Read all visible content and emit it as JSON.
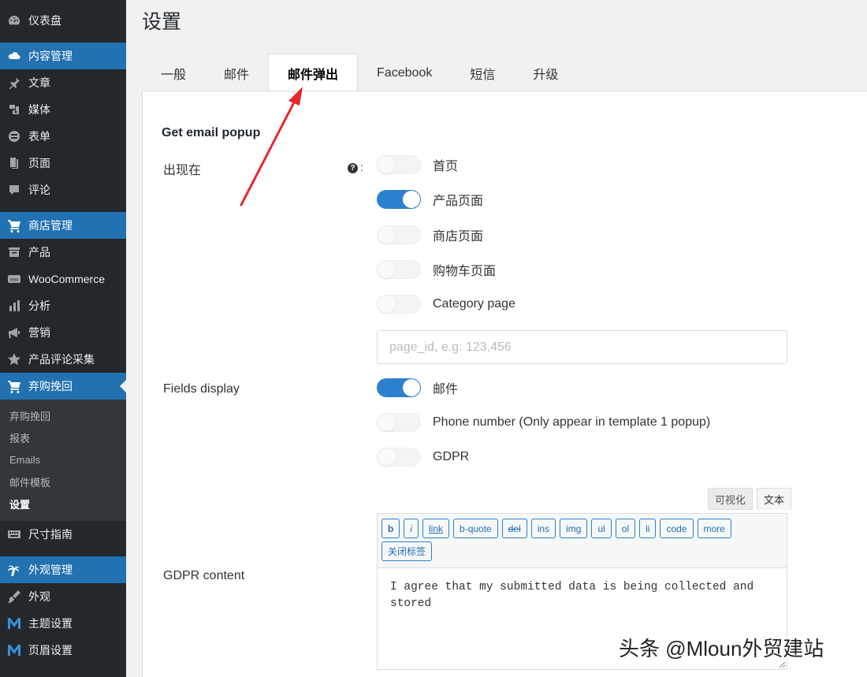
{
  "sidebar": {
    "items": [
      {
        "key": "dashboard",
        "label": "仪表盘",
        "icon": "dashboard-icon",
        "style": "normal"
      },
      {
        "key": "content-mgmt",
        "label": "内容管理",
        "icon": "cloud-icon",
        "style": "head"
      },
      {
        "key": "posts",
        "label": "文章",
        "icon": "pin-icon",
        "style": "normal"
      },
      {
        "key": "media",
        "label": "媒体",
        "icon": "media-icon",
        "style": "normal"
      },
      {
        "key": "forms",
        "label": "表单",
        "icon": "form-icon",
        "style": "normal"
      },
      {
        "key": "pages",
        "label": "页面",
        "icon": "page-icon",
        "style": "normal"
      },
      {
        "key": "comments",
        "label": "评论",
        "icon": "comment-icon",
        "style": "normal"
      },
      {
        "key": "store-mgmt",
        "label": "商店管理",
        "icon": "cart-icon",
        "style": "head"
      },
      {
        "key": "products",
        "label": "产品",
        "icon": "archive-icon",
        "style": "normal"
      },
      {
        "key": "woocommerce",
        "label": "WooCommerce",
        "icon": "woo-icon",
        "style": "normal"
      },
      {
        "key": "analytics",
        "label": "分析",
        "icon": "bar-chart-icon",
        "style": "normal"
      },
      {
        "key": "marketing",
        "label": "营销",
        "icon": "megaphone-icon",
        "style": "normal"
      },
      {
        "key": "review-collect",
        "label": "产品评论采集",
        "icon": "star-icon",
        "style": "normal"
      },
      {
        "key": "abandoned-cart",
        "label": "弃购挽回",
        "icon": "cart-icon",
        "style": "current"
      }
    ],
    "submenu": [
      {
        "label": "弃购挽回",
        "active": false
      },
      {
        "label": "报表",
        "active": false
      },
      {
        "label": "Emails",
        "active": false
      },
      {
        "label": "邮件模板",
        "active": false
      },
      {
        "label": "设置",
        "active": true
      }
    ],
    "items_after": [
      {
        "key": "size-guide",
        "label": "尺寸指南",
        "icon": "keyboard-icon",
        "style": "normal",
        "gap": true
      },
      {
        "key": "appearance-mgmt",
        "label": "外观管理",
        "icon": "palm-icon",
        "style": "head",
        "gap": true
      },
      {
        "key": "appearance",
        "label": "外观",
        "icon": "brush-icon",
        "style": "normal"
      },
      {
        "key": "theme-settings",
        "label": "主题设置",
        "icon": "m-logo-icon",
        "style": "normal"
      },
      {
        "key": "header-settings",
        "label": "页眉设置",
        "icon": "m-logo-icon",
        "style": "normal"
      }
    ]
  },
  "page": {
    "title": "设置",
    "tabs": [
      {
        "label": "一般",
        "active": false
      },
      {
        "label": "邮件",
        "active": false
      },
      {
        "label": "邮件弹出",
        "active": true
      },
      {
        "label": "Facebook",
        "active": false
      },
      {
        "label": "短信",
        "active": false
      },
      {
        "label": "升级",
        "active": false
      }
    ]
  },
  "form": {
    "section_title": "Get email popup",
    "appear_label": "出现在",
    "help_symbol": "?",
    "help_colon": ":",
    "appear_options": [
      {
        "label": "首页",
        "on": false
      },
      {
        "label": "产品页面",
        "on": true
      },
      {
        "label": "商店页面",
        "on": false
      },
      {
        "label": "购物车页面",
        "on": false
      },
      {
        "label": "Category page",
        "on": false
      }
    ],
    "page_id_placeholder": "page_id, e.g: 123,456",
    "fields_label": "Fields display",
    "fields_options": [
      {
        "label": "邮件",
        "on": true
      },
      {
        "label": "Phone number (Only appear in template 1 popup)",
        "on": false
      },
      {
        "label": "GDPR",
        "on": false
      }
    ],
    "gdpr_label": "GDPR content",
    "editor_tabs": [
      {
        "label": "可视化",
        "active": false
      },
      {
        "label": "文本",
        "active": true
      }
    ],
    "qt_buttons": [
      "b",
      "i",
      "link",
      "b-quote",
      "del",
      "ins",
      "img",
      "ul",
      "ol",
      "li",
      "code",
      "more",
      "关闭标签"
    ],
    "gdpr_text": "I agree that my submitted data is being collected and stored"
  },
  "watermark": "头条 @Mloun外贸建站",
  "colors": {
    "accent": "#2271b1",
    "toggle_on": "#2c80d0",
    "arrow": "#e8262b",
    "sidebar_bg": "#23282d"
  }
}
